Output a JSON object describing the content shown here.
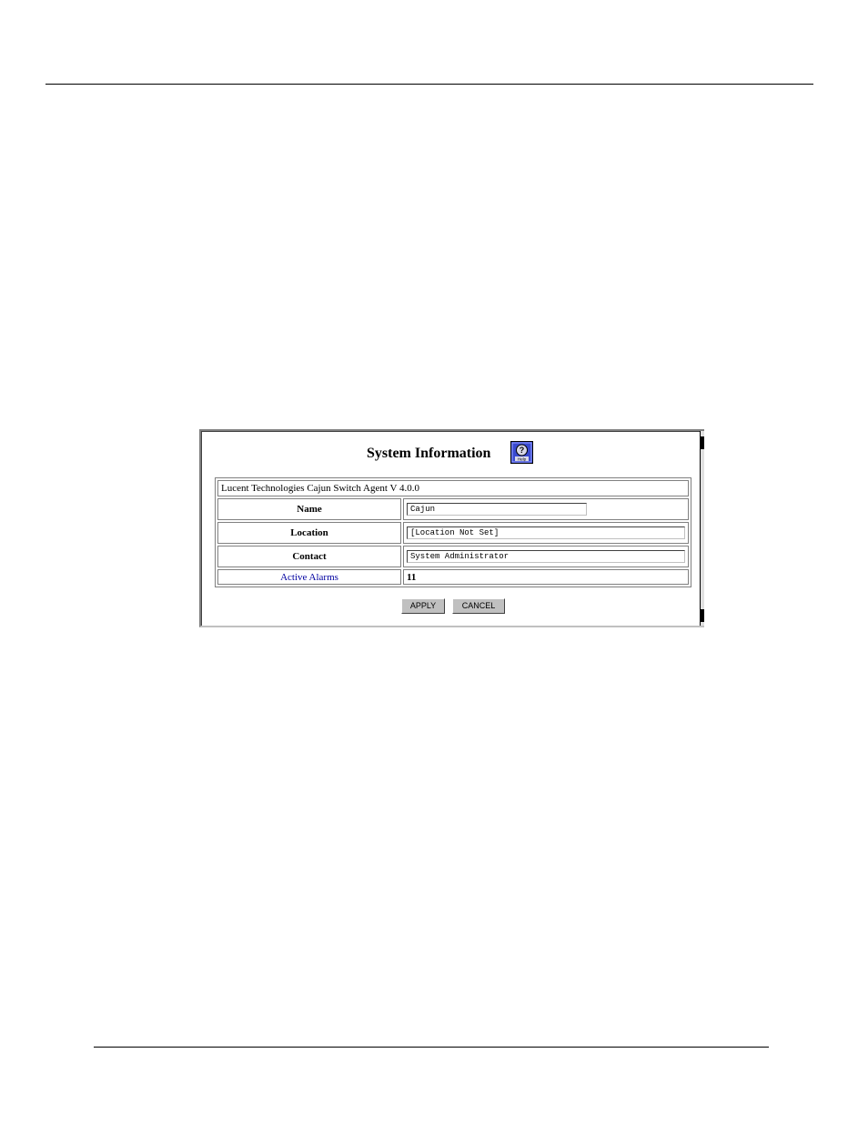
{
  "panel": {
    "title": "System Information",
    "help_icon": "help-icon",
    "header": "Lucent Technologies Cajun Switch Agent V 4.0.0"
  },
  "fields": {
    "name_label": "Name",
    "name_value": "Cajun",
    "location_label": "Location",
    "location_value": "[Location Not Set]",
    "contact_label": "Contact",
    "contact_value": "System Administrator",
    "alarms_label": "Active Alarms",
    "alarms_value": "11"
  },
  "buttons": {
    "apply_label": "APPLY",
    "cancel_label": "CANCEL"
  },
  "colors": {
    "link": "#0000a0",
    "help_button": "#2c3cc8",
    "button_face": "#c0c0c0"
  }
}
